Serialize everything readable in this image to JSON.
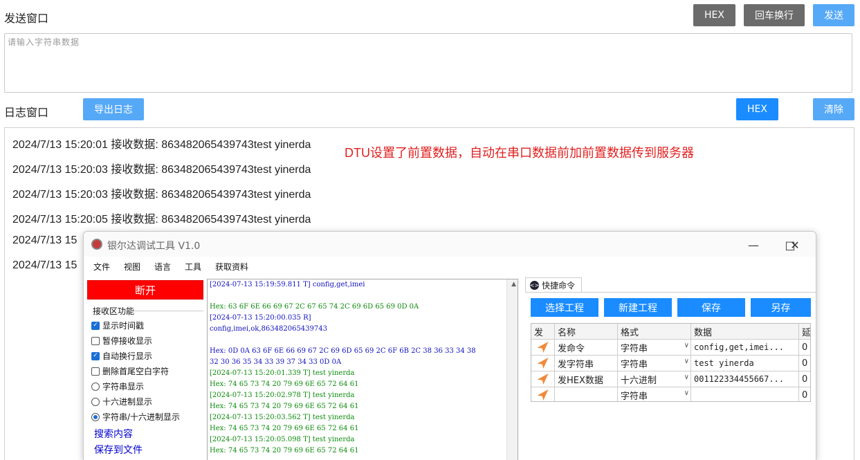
{
  "send": {
    "label": "发送窗口",
    "hex_label": "HEX",
    "crlf_label": "回车换行",
    "send_label": "发送",
    "placeholder": "请输入字符串数据"
  },
  "log": {
    "label": "日志窗口",
    "export_label": "导出日志",
    "hex_label": "HEX",
    "clear_label": "清除",
    "lines": [
      "2024/7/13 15:20:01 接收数据: 863482065439743test yinerda",
      "2024/7/13 15:20:03 接收数据: 863482065439743test yinerda",
      "2024/7/13 15:20:03 接收数据: 863482065439743test yinerda",
      "2024/7/13 15:20:05 接收数据: 863482065439743test yinerda",
      "2024/7/13 15",
      "2024/7/13 15"
    ],
    "annotation": "DTU设置了前置数据，自动在串口数据前加前置数据传到服务器",
    "annotation_color": "#e02020"
  },
  "app": {
    "title": "银尔达调试工具 V1.0",
    "menu": [
      "文件",
      "视图",
      "语言",
      "工具",
      "获取资料"
    ],
    "disconnect_label": "断开",
    "rx_section_label": "接收区功能",
    "options": [
      {
        "label": "显示时间戳",
        "kind": "checkbox",
        "checked": true
      },
      {
        "label": "暂停接收显示",
        "kind": "checkbox",
        "checked": false
      },
      {
        "label": "自动换行显示",
        "kind": "checkbox",
        "checked": true
      },
      {
        "label": "删除首尾空白字符",
        "kind": "checkbox",
        "checked": false
      },
      {
        "label": "字符串显示",
        "kind": "radio",
        "checked": false
      },
      {
        "label": "十六进制显示",
        "kind": "radio",
        "checked": false
      },
      {
        "label": "字符串/十六进制显示",
        "kind": "radio",
        "checked": true
      }
    ],
    "search_label": "搜索内容",
    "save_file_label": "保存到文件",
    "rx_lines": [
      {
        "text": "[2024-07-13 15:19:59.811 T] config,get,imei",
        "color": "blue"
      },
      {
        "text": "",
        "color": "blue"
      },
      {
        "text": "Hex: 63 6F 6E 66 69 67 2C 67 65 74 2C 69 6D 65 69 0D 0A",
        "color": "green"
      },
      {
        "text": "[2024-07-13 15:20:00.035 R]",
        "color": "blue"
      },
      {
        "text": "config,imei,ok,863482065439743",
        "color": "blue"
      },
      {
        "text": "",
        "color": "blue"
      },
      {
        "text": "Hex: 0D 0A 63 6F 6E 66 69 67 2C 69 6D 65 69 2C 6F 6B 2C 38 36 33 34 38",
        "color": "blue"
      },
      {
        "text": "32 30 36 35 34 33 39 37 34 33 0D 0A",
        "color": "blue"
      },
      {
        "text": "[2024-07-13 15:20:01.339 T] test yinerda",
        "color": "green"
      },
      {
        "text": "Hex: 74 65 73 74 20 79 69 6E 65 72 64 61",
        "color": "green"
      },
      {
        "text": "[2024-07-13 15:20:02.978 T] test yinerda",
        "color": "green"
      },
      {
        "text": "Hex: 74 65 73 74 20 79 69 6E 65 72 64 61",
        "color": "green"
      },
      {
        "text": "[2024-07-13 15:20:03.562 T] test yinerda",
        "color": "green"
      },
      {
        "text": "Hex: 74 65 73 74 20 79 69 6E 65 72 64 61",
        "color": "green"
      },
      {
        "text": "[2024-07-13 15:20:05.098 T] test yinerda",
        "color": "green"
      },
      {
        "text": "Hex: 74 65 73 74 20 79 69 6E 65 72 64 61",
        "color": "green"
      }
    ],
    "quick": {
      "tab_label": "快捷命令",
      "buttons": [
        "选择工程",
        "新建工程",
        "保存",
        "另存"
      ],
      "headers": [
        "发",
        "名称",
        "格式",
        "数据",
        "延"
      ],
      "rows": [
        {
          "name": "发命令",
          "format": "字符串",
          "data": "config,get,imei...",
          "delay": "0"
        },
        {
          "name": "发字符串",
          "format": "字符串",
          "data": "test yinerda",
          "delay": "0"
        },
        {
          "name": "发HEX数据",
          "format": "十六进制",
          "data": "001122334455667...",
          "delay": "0"
        },
        {
          "name": "",
          "format": "字符串",
          "data": "",
          "delay": "0"
        }
      ]
    }
  }
}
